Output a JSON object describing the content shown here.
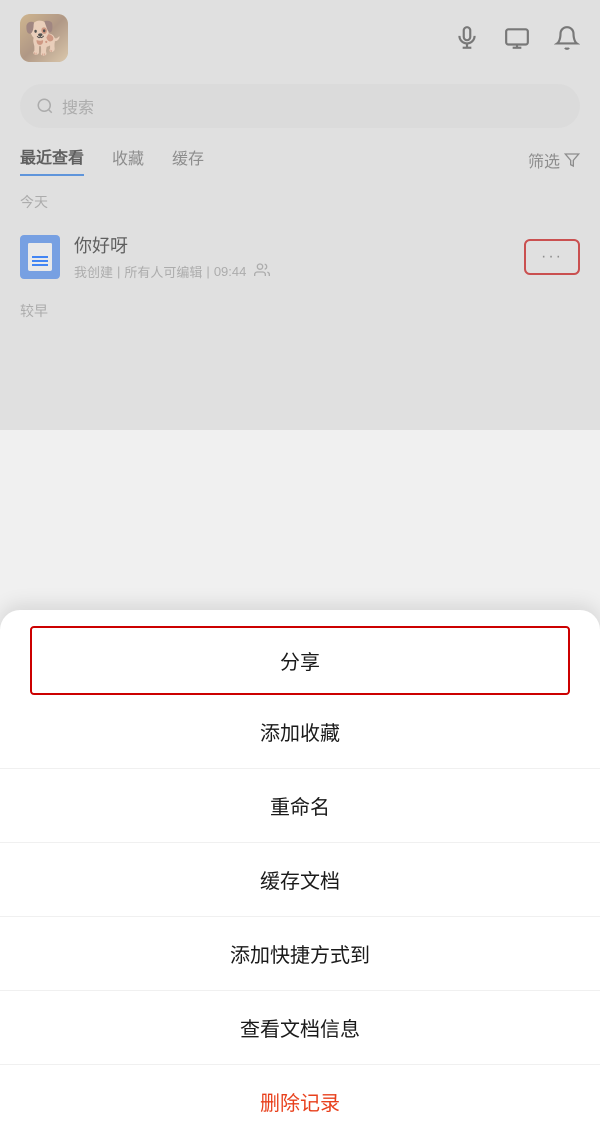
{
  "header": {
    "mic_icon": "🎤",
    "screen_icon": "⬛",
    "bell_icon": "🔔"
  },
  "search": {
    "placeholder": "搜索"
  },
  "tabs": [
    {
      "label": "最近查看",
      "active": true
    },
    {
      "label": "收藏",
      "active": false
    },
    {
      "label": "缓存",
      "active": false
    }
  ],
  "filter": {
    "label": "筛选"
  },
  "section_today": "今天",
  "section_earlier": "较早",
  "document": {
    "title": "你好呀",
    "meta_created": "我创建",
    "meta_separator": "|",
    "meta_permission": "所有人可编辑",
    "meta_time": "09:44",
    "more_dots": "···"
  },
  "menu": {
    "share": "分享",
    "add_favorite": "添加收藏",
    "rename": "重命名",
    "cache_doc": "缓存文档",
    "add_shortcut": "添加快捷方式到",
    "view_info": "查看文档信息",
    "delete_record": "删除记录"
  }
}
